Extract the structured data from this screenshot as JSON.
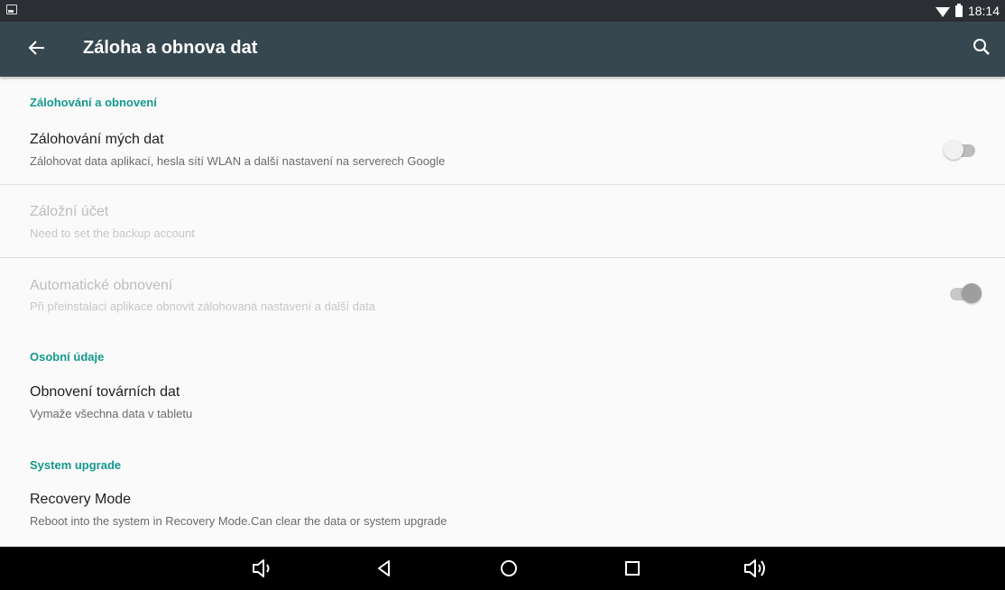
{
  "status_bar": {
    "time": "18:14"
  },
  "app_bar": {
    "title": "Záloha a obnova dat"
  },
  "sections": {
    "backup_restore": "Zálohování a obnovení",
    "personal_data": "Osobní údaje",
    "system_upgrade": "System upgrade"
  },
  "items": {
    "backup_my_data": {
      "title": "Zálohování mých dat",
      "summary": "Zálohovat data aplikací, hesla sítí WLAN a další nastavení na serverech Google",
      "toggle_on": false
    },
    "backup_account": {
      "title": "Záložní účet",
      "summary": "Need to set the backup account"
    },
    "auto_restore": {
      "title": "Automatické obnovení",
      "summary": "Při přeinstalaci aplikace obnovit zálohovaná nastavení a další data",
      "toggle_on": true
    },
    "factory_reset": {
      "title": "Obnovení továrních dat",
      "summary": "Vymaže všechna data v tabletu"
    },
    "recovery_mode": {
      "title": "Recovery Mode",
      "summary": "Reboot into the system in Recovery Mode.Can clear the data or system upgrade"
    }
  },
  "icons": [
    "notification-icon",
    "wifi-icon",
    "battery-icon",
    "back-arrow-icon",
    "search-icon",
    "volume-down-icon",
    "back-icon",
    "home-icon",
    "recents-icon",
    "volume-up-icon"
  ],
  "colors": {
    "accent": "#14998c",
    "app_bar": "#37474f",
    "status_bar": "#2b2f33"
  }
}
